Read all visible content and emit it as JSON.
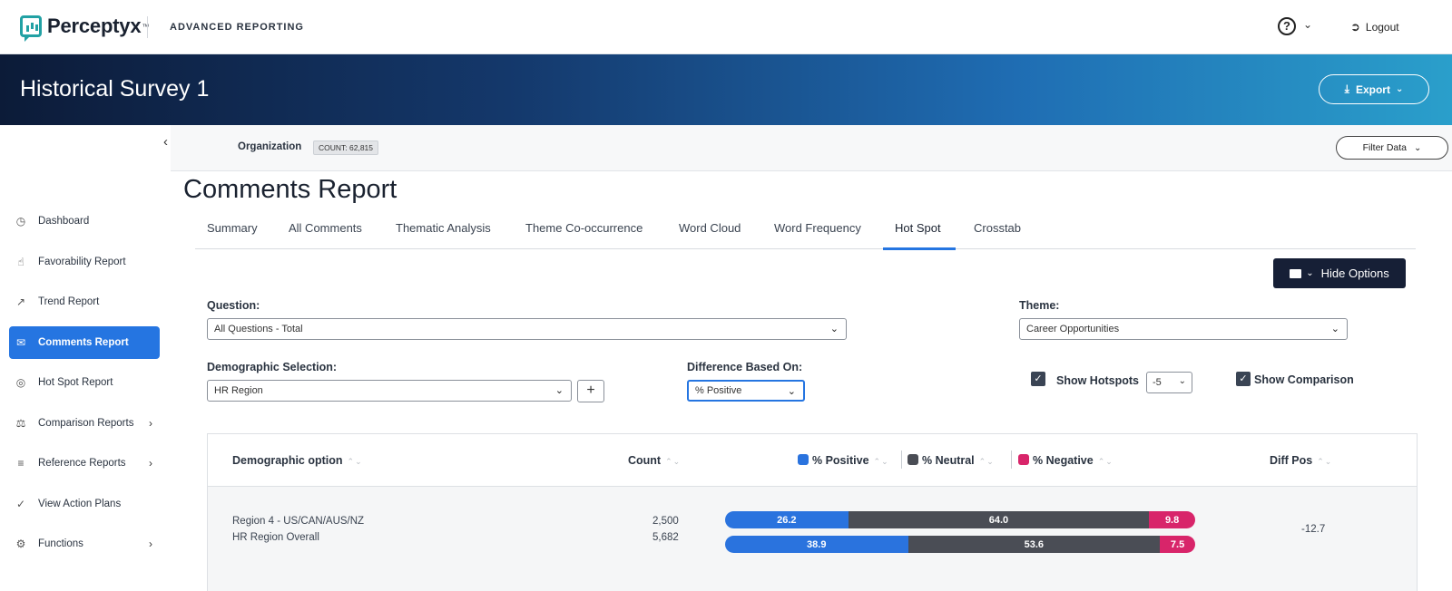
{
  "header": {
    "brand": "Perceptyx",
    "brand_tm": "™",
    "app_title": "ADVANCED REPORTING",
    "help_icon": "?",
    "logout_label": "Logout"
  },
  "banner": {
    "survey_title": "Historical Survey 1",
    "export_label": "Export"
  },
  "sidebar": {
    "items": [
      {
        "label": "Dashboard",
        "icon": "speedometer-icon"
      },
      {
        "label": "Favorability Report",
        "icon": "thumbs-up-icon"
      },
      {
        "label": "Trend Report",
        "icon": "trend-line-icon"
      },
      {
        "label": "Comments Report",
        "icon": "chat-bubbles-icon",
        "active": true
      },
      {
        "label": "Hot Spot Report",
        "icon": "target-icon"
      },
      {
        "label": "Comparison Reports",
        "icon": "scale-icon",
        "has_submenu": true
      },
      {
        "label": "Reference Reports",
        "icon": "bar-list-icon",
        "has_submenu": true
      },
      {
        "label": "View Action Plans",
        "icon": "check-circle-icon"
      },
      {
        "label": "Functions",
        "icon": "gear-icon",
        "has_submenu": true
      }
    ]
  },
  "filterbar": {
    "org_label": "Organization",
    "count_badge": "COUNT: 62,815",
    "filter_label": "Filter Data"
  },
  "page": {
    "title": "Comments Report",
    "tabs": [
      "Summary",
      "All Comments",
      "Thematic Analysis",
      "Theme Co-occurrence",
      "Word Cloud",
      "Word Frequency",
      "Hot Spot",
      "Crosstab"
    ],
    "active_tab": "Hot Spot",
    "hide_options_label": "Hide Options"
  },
  "options": {
    "question_label": "Question:",
    "question_value": "All Questions - Total",
    "theme_label": "Theme:",
    "theme_value": "Career Opportunities",
    "demographic_label": "Demographic Selection:",
    "demographic_value": "HR Region",
    "difference_label": "Difference Based On:",
    "difference_value": "% Positive",
    "show_hotspots_label": "Show Hotspots",
    "hotspot_threshold": "-5",
    "show_hotspots_checked": true,
    "show_comparison_label": "Show Comparison",
    "show_comparison_checked": true
  },
  "table": {
    "columns": {
      "demographic": "Demographic option",
      "count": "Count",
      "positive": "% Positive",
      "neutral": "% Neutral",
      "negative": "% Negative",
      "diff": "Diff Pos"
    },
    "colors": {
      "positive": "#2a73de",
      "neutral": "#4a4d55",
      "negative": "#d8256a"
    },
    "rows": [
      {
        "name": "Region 4 - US/CAN/AUS/NZ",
        "compare_name": "HR Region Overall",
        "count": "2,500",
        "compare_count": "5,682",
        "positive": "26.2",
        "neutral": "64.0",
        "negative": "9.8",
        "compare_positive": "38.9",
        "compare_neutral": "53.6",
        "compare_negative": "7.5",
        "diff": "-12.7"
      }
    ]
  }
}
